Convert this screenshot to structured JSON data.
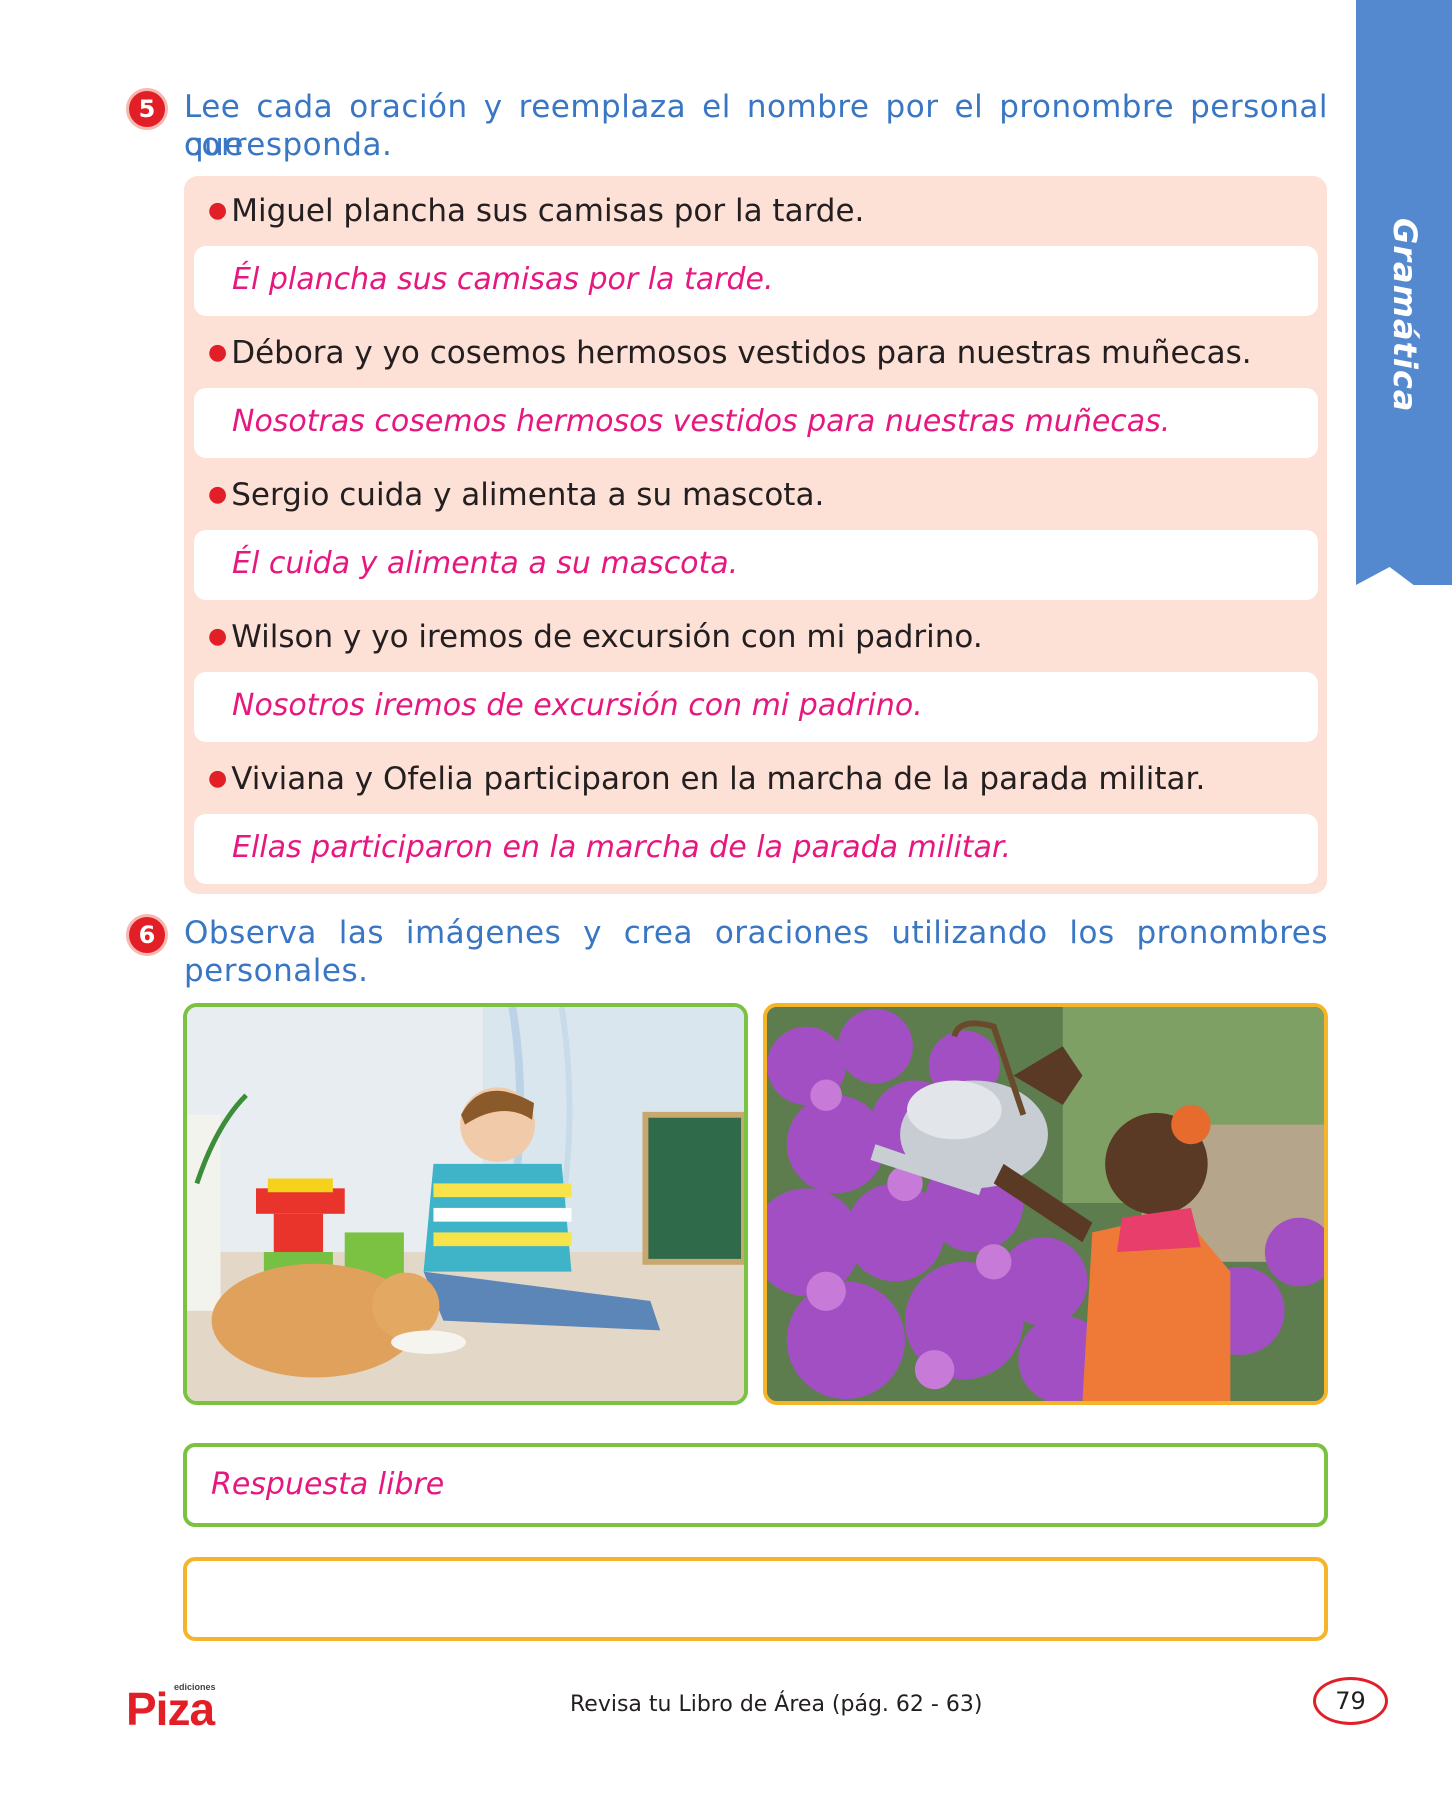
{
  "side_tab": {
    "label": "Gramática"
  },
  "activity5": {
    "number": "5",
    "instruction_line1": "Lee cada oración y reemplaza el nombre por el pronombre personal que",
    "instruction_line2": "corresponda.",
    "items": [
      {
        "prompt": "Miguel plancha sus camisas por la tarde.",
        "answer": "Él plancha sus camisas por la tarde."
      },
      {
        "prompt": "Débora y yo cosemos hermosos vestidos para nuestras muñecas.",
        "answer": "Nosotras cosemos hermosos vestidos para nuestras muñecas."
      },
      {
        "prompt": "Sergio cuida y alimenta a su mascota.",
        "answer": "Él cuida y alimenta a su mascota."
      },
      {
        "prompt": "Wilson y yo iremos de excursión con mi padrino.",
        "answer": "Nosotros iremos de excursión con mi padrino."
      },
      {
        "prompt": "Viviana y Ofelia participaron en la marcha de la parada militar.",
        "answer": "Ellas participaron en la marcha de la parada militar."
      }
    ]
  },
  "activity6": {
    "number": "6",
    "instruction_line1": "Observa las imágenes y crea oraciones utilizando los pronombres",
    "instruction_line2": "personales.",
    "photos": [
      "boy-petting-cat-photo",
      "girl-watering-flowers-photo"
    ],
    "responses": [
      "Respuesta libre",
      ""
    ]
  },
  "footer": {
    "logo_small": "ediciones",
    "logo_main": "Piza",
    "reference": "Revisa tu Libro de Área (pág. 62 - 63)",
    "page_number": "79"
  },
  "colors": {
    "blue": "#3976c4",
    "red": "#e21f26",
    "magenta": "#e6177f",
    "panel": "#fde0d6",
    "green": "#7cc242",
    "yellow": "#f5b52b",
    "tab": "#5589cf"
  }
}
